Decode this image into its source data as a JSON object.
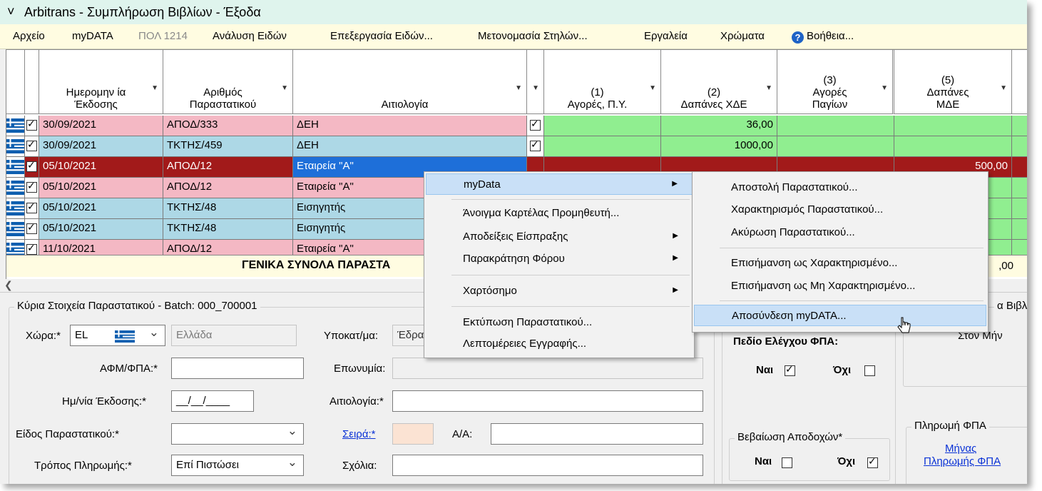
{
  "window": {
    "title": "Arbitrans - Συμπλήρωση Βιβλίων - Έξοδα"
  },
  "menu": {
    "items": [
      "Αρχείο",
      "myDATA",
      "ΠΟΛ 1214",
      "Ανάλυση Ειδών",
      "Επεξεργασία Ειδών...",
      "Μετονομασία Στηλών...",
      "Εργαλεία",
      "Χρώματα",
      "Βοήθεια..."
    ]
  },
  "grid": {
    "headers": {
      "date": [
        "Ημερομην ία",
        "Έκδοσης"
      ],
      "docnum": [
        "Αριθμός",
        "Παραστατικού"
      ],
      "reason": [
        "Αιτιολογία"
      ],
      "c1": [
        "(1)",
        "Αγορές, Π.Υ."
      ],
      "c2": [
        "(2)",
        "Δαπάνες ΧΔΕ"
      ],
      "c3": [
        "(3)",
        "Αγορές",
        "Παγίων"
      ],
      "c5": [
        "(5)",
        "Δαπάνες",
        "ΜΔΕ"
      ]
    },
    "rows": [
      {
        "date": "30/09/2021",
        "doc": "ΑΠΟΔ/333",
        "reason": "ΔΕΗ",
        "c1": "",
        "c2": "36,00",
        "c3": "",
        "c5": ""
      },
      {
        "date": "30/09/2021",
        "doc": "ΤΚΤΗΣ/459",
        "reason": "ΔΕΗ",
        "c1": "",
        "c2": "1000,00",
        "c3": "",
        "c5": ""
      },
      {
        "date": "05/10/2021",
        "doc": "ΑΠΟΔ/12",
        "reason": "Εταιρεία \"Α\"",
        "c1": "",
        "c2": "",
        "c3": "",
        "c5": "500,00"
      },
      {
        "date": "05/10/2021",
        "doc": "ΑΠΟΔ/12",
        "reason": "Εταιρεία \"Α\"",
        "c1": "",
        "c2": "",
        "c3": "",
        "c5": ""
      },
      {
        "date": "05/10/2021",
        "doc": "ΤΚΤΗΣ/48",
        "reason": "Εισηγητής",
        "c1": "",
        "c2": "",
        "c3": "",
        "c5": ""
      },
      {
        "date": "05/10/2021",
        "doc": "ΤΚΤΗΣ/48",
        "reason": "Εισηγητής",
        "c1": "",
        "c2": "",
        "c3": "",
        "c5": ""
      },
      {
        "date": "11/10/2021",
        "doc": "ΑΠΟΔ/12",
        "reason": "Εταιρεία \"Α\"",
        "c1": "",
        "c2": "",
        "c3": "",
        "c5": ""
      }
    ],
    "totals_label": "ΓΕΝΙΚΑ ΣΥΝΟΛΑ ΠΑΡΑΣΤΑ",
    "totals_value": ",00"
  },
  "form": {
    "main_legend": "Κύρια Στοιχεία Παραστατικού - Batch: 000_700001",
    "country_label": "Χώρα:*",
    "country_code": "EL",
    "country_name": "Ελλάδα",
    "vat_label": "ΑΦΜ/ΦΠΑ:*",
    "issue_date_label": "Ημ/νία Έκδοσης:*",
    "issue_date_mask": "__/__/____",
    "doc_type_label": "Είδος Παραστατικού:*",
    "payment_label": "Τρόπος Πληρωμής:*",
    "payment_value": "Επί Πιστώσει",
    "subcat_label": "Υποκατ/μα:",
    "subcat_value": "Έδρα",
    "name_label": "Επωνυμία:",
    "reason_label": "Αιτιολογία:*",
    "series_label": "Σειρά:*",
    "aa_label": "Α/Α:",
    "notes_label": "Σχόλια:",
    "vat_check_title": "Πεδίο Ελέγχου ΦΠΑ:",
    "yes": "Ναι",
    "no": "Όχι",
    "income_legend": "Βεβαίωση Αποδοχών*",
    "right_legend_partial": "α Βιβλ",
    "month_label": "Στον Μήν",
    "vat_payment_legend": "Πληρωμή ΦΠΑ",
    "vat_payment_link": [
      "Μήνας",
      "Πληρωμής ΦΠΑ"
    ]
  },
  "context_menu": {
    "items": [
      {
        "label": "myData",
        "submenu": true
      },
      {
        "label": "Άνοιγμα Καρτέλας Προμηθευτή...",
        "submenu": false
      },
      {
        "label": "Αποδείξεις Είσπραξης",
        "submenu": true
      },
      {
        "label": "Παρακράτηση Φόρου",
        "submenu": true
      },
      {
        "label": "Χαρτόσημο",
        "submenu": true
      },
      {
        "label": "Εκτύπωση Παραστατικού...",
        "submenu": false
      },
      {
        "label": "Λεπτομέρειες Εγγραφής...",
        "submenu": false
      }
    ]
  },
  "submenu": {
    "items": [
      "Αποστολή Παραστατικού...",
      "Χαρακτηρισμός Παραστατικού...",
      "Ακύρωση Παραστατικού...",
      "Επισήμανση ως Χαρακτηρισμένο...",
      "Επισήμανση ως Μη Χαρακτηρισμένο...",
      "Αποσύνδεση myDATA..."
    ]
  },
  "colors": {
    "pink_row": "#f4b8c4",
    "blue_row": "#add8e6",
    "green_cell": "#90ee90",
    "selected_row": "#a21a1a",
    "highlight": "#c9e0f7"
  },
  "icons": [
    "app-icon",
    "help-icon",
    "greek-flag-icon",
    "mouse-cursor-icon"
  ]
}
